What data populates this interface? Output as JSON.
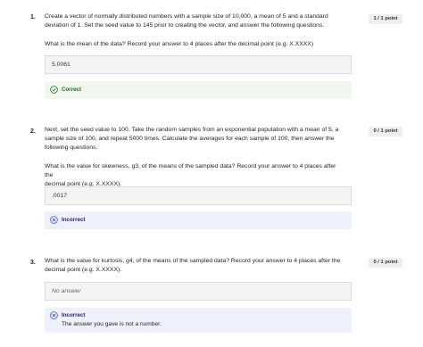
{
  "questions": [
    {
      "number": "1.",
      "points": "1 / 1 point",
      "text_lines": [
        "Create a vector of normally distributed numbers with a sample size of 10,000, a mean of 5 and a standard",
        "deviation of 1. Set the seed value to 145 prior to creating the vector, and answer the following questions."
      ],
      "prompt": "What is the mean of the data? Record your answer to 4 places after the decimal point (e.g. X.XXXX)",
      "answer": "5.0061",
      "feedback": {
        "status": "Correct",
        "message": ""
      }
    },
    {
      "number": "2.",
      "points": "0 / 1 point",
      "text_lines": [
        "Next, set the seed value to 100. Take the random samples from an exponential population with a mean of 5, a",
        "sample size of 100, and repeat 5000 times. Calculate the averages for each sample of 100, then answer the",
        "following questions."
      ],
      "prompt_lines": [
        "What is the value for skewness, g3,  of the means of the sampled data? Record your answer to 4 places after the",
        "decimal point (e.g. X.XXXX)."
      ],
      "answer": ".0017",
      "feedback": {
        "status": "Incorrect",
        "message": ""
      }
    },
    {
      "number": "3.",
      "points": "0 / 1 point",
      "text_lines": [
        "What is the value for kurtosis, g4,  of the means of the sampled data? Record your answer to 4 places after the",
        "decimal point (e.g. X.XXXX)."
      ],
      "answer_placeholder": "No answer",
      "feedback": {
        "status": "Incorrect",
        "message": "The answer you gave is not a number."
      }
    }
  ],
  "colors": {
    "correct": "#1e6b2b",
    "incorrect": "#3b4bd6",
    "correct_bg": "#f1f7ef",
    "incorrect_bg": "#eef1fc"
  }
}
